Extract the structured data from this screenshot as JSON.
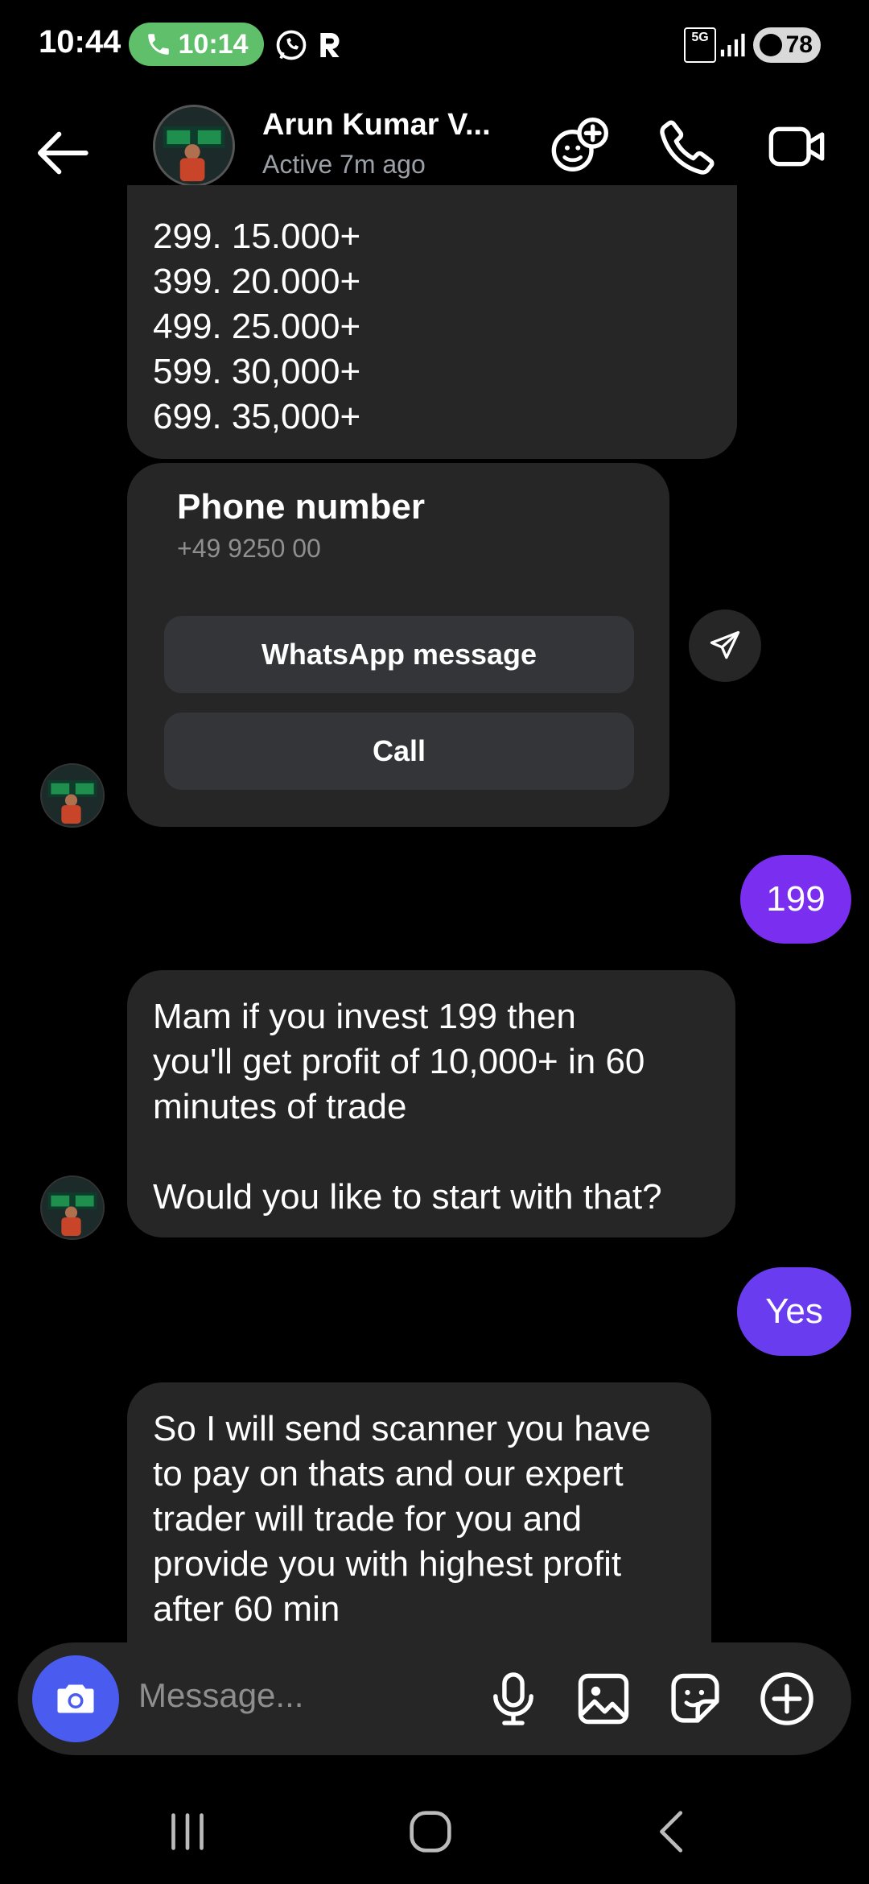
{
  "status_bar": {
    "time": "10:44",
    "call_timer": "10:14",
    "network": "5G",
    "battery": "78"
  },
  "header": {
    "contact_name": "Arun Kumar V...",
    "activity": "Active 7m ago"
  },
  "messages": {
    "price_list": "299. 15.000+\n399.  20.000+\n499.  25.000+\n599.  30,000+\n699. 35,000+",
    "contact_card": {
      "title": "Phone number",
      "number": "+49 9250 00",
      "whatsapp_button": "WhatsApp message",
      "call_button": "Call"
    },
    "sent_1": "199",
    "received_2": "Mam if you invest 199 then\nyou'll get profit of 10,000+ in 60\nminutes of trade\n\nWould you like to start with that?",
    "sent_2": "Yes",
    "received_3": "So I will send scanner you have\nto pay on thats and our expert\ntrader will trade for you and\nprovide you with highest profit\nafter 60 min"
  },
  "composer": {
    "placeholder": "Message..."
  },
  "colors": {
    "sent_1": "#7a2ff0",
    "sent_2": "#6a3cf0",
    "camera": "#4a5cf0",
    "bubble": "#262626"
  },
  "icons": [
    "back-arrow-icon",
    "add-friend-icon",
    "phone-icon",
    "video-icon",
    "camera-icon",
    "microphone-icon",
    "gallery-icon",
    "sticker-icon",
    "plus-icon",
    "share-icon"
  ]
}
